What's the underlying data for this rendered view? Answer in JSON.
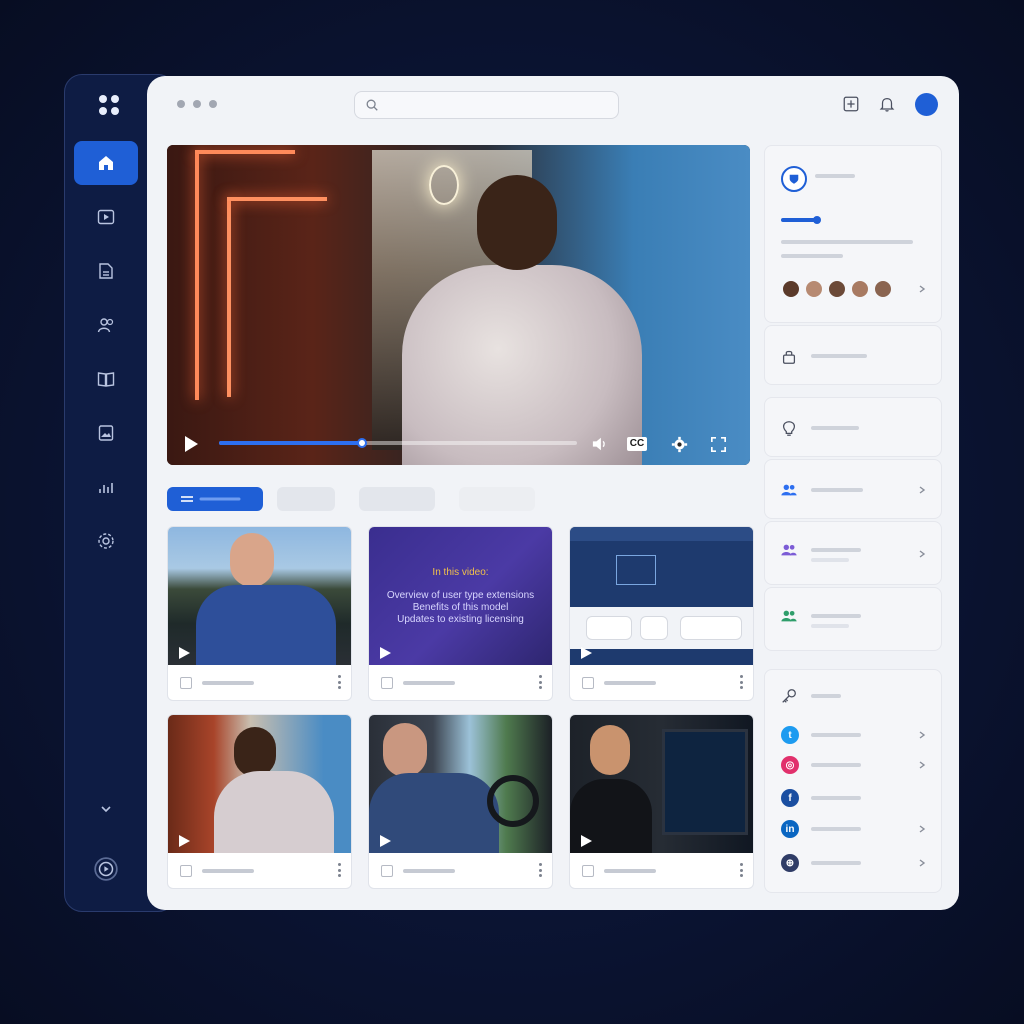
{
  "search": {
    "placeholder": "",
    "value": ""
  },
  "sidebar": {
    "items": [
      {
        "icon": "home-icon",
        "active": true
      },
      {
        "icon": "video-icon"
      },
      {
        "icon": "document-icon"
      },
      {
        "icon": "users-icon"
      },
      {
        "icon": "book-icon"
      },
      {
        "icon": "image-icon"
      },
      {
        "icon": "analytics-icon"
      },
      {
        "icon": "settings-icon"
      }
    ],
    "footer": {
      "icon": "play-circle-icon"
    }
  },
  "header": {
    "icons": [
      "add-icon",
      "bell-icon",
      "avatar"
    ]
  },
  "player": {
    "progress": 0.4,
    "controls": {
      "cc_label": "CC"
    }
  },
  "tabs": [
    {
      "active": true
    },
    {},
    {},
    {}
  ],
  "videos": [
    {
      "thumb": "man-outdoors"
    },
    {
      "thumb": "slide",
      "heading": "In this video:",
      "lines": [
        "Overview of user type extensions",
        "Benefits of this model",
        "Updates to existing licensing"
      ]
    },
    {
      "thumb": "dashboard"
    },
    {
      "thumb": "speaker"
    },
    {
      "thumb": "driver"
    },
    {
      "thumb": "operator"
    }
  ],
  "right_panel": {
    "icons": [
      "shield-icon",
      "lock-icon",
      "lightbulb-icon",
      "team-icon",
      "group-icon",
      "people-icon",
      "key-icon"
    ],
    "social": [
      {
        "name": "twitter-icon",
        "color": "#1d9bf0",
        "glyph": "t"
      },
      {
        "name": "instagram-icon",
        "color": "#e1306c",
        "glyph": "◎"
      },
      {
        "name": "facebook-icon",
        "color": "#1a4ea1",
        "glyph": "f"
      },
      {
        "name": "linkedin-icon",
        "color": "#0a66c2",
        "glyph": "in"
      },
      {
        "name": "globe-icon",
        "color": "#2f3c66",
        "glyph": "⊕"
      }
    ]
  },
  "colors": {
    "accent": "#1f5fd6",
    "sidebar": "#0e1c44",
    "panel": "#f1f3f7",
    "background": "#0b1433"
  }
}
